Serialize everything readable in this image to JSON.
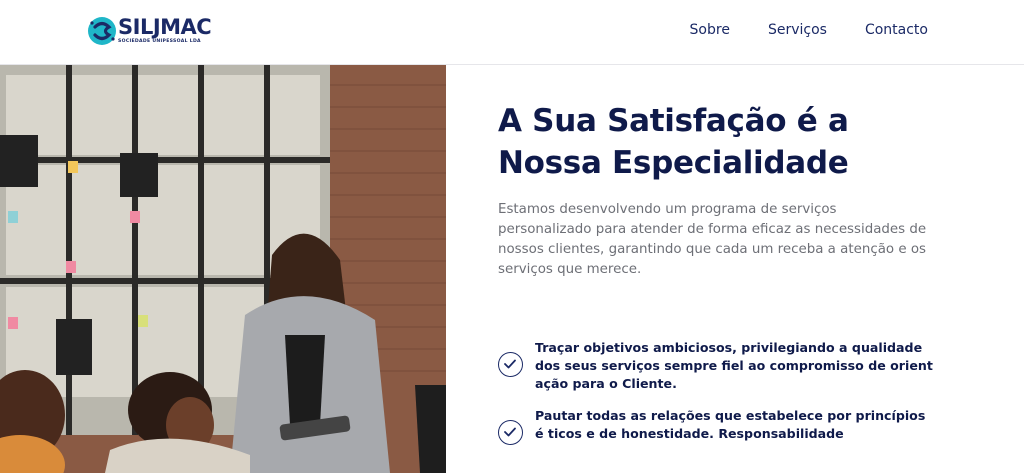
{
  "header": {
    "logo": {
      "name": "SILJMAC",
      "subtitle": "SOCIEDADE UNIPESSOAL LDA"
    },
    "nav": [
      {
        "label": "Sobre"
      },
      {
        "label": "Serviços"
      },
      {
        "label": "Contacto"
      }
    ]
  },
  "hero": {
    "title_line1": "A Sua Satisfação é a",
    "title_line2": "Nossa Especialidade",
    "description": "Estamos desenvolvendo um programa de serviços personalizado para atender de forma eficaz as necessidades de nossos clientes, garantindo que cada um receba a atenção e os serviços que merece.",
    "image": "office-team-photo"
  },
  "features": [
    {
      "icon": "check-circle-icon",
      "text": "Traçar objetivos ambiciosos, privilegiando a qualidade dos seus serviços sempre fiel ao compromisso de orient ação para o Cliente."
    },
    {
      "icon": "check-circle-icon",
      "text": "Pautar todas as relações que estabelece por princípios é ticos e de honestidade. Responsabilidade"
    }
  ],
  "colors": {
    "navy": "#0f1a4a",
    "accent_teal": "#1fb6c8",
    "body_text": "#6d6f76"
  }
}
